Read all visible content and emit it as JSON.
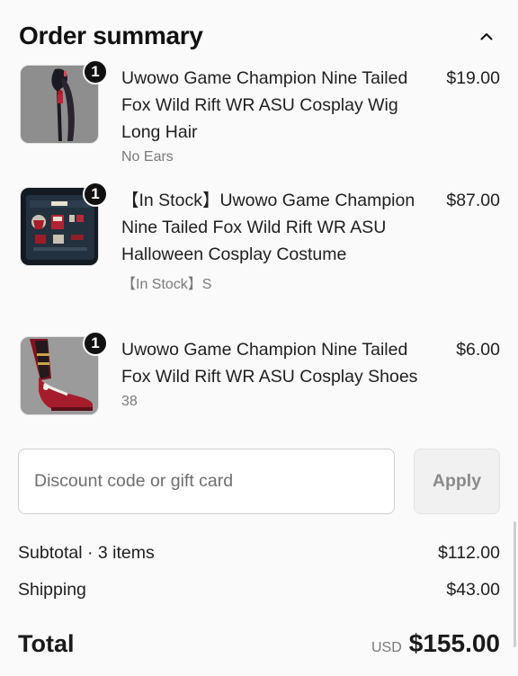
{
  "header": {
    "title": "Order summary",
    "toggle_icon": "chevron-up-icon"
  },
  "items": [
    {
      "quantity": "1",
      "title": "Uwowo Game Champion Nine Tailed Fox Wild Rift WR ASU Cosplay Wig Long Hair",
      "variant": "No Ears",
      "price": "$19.00",
      "image": "wig-product-image"
    },
    {
      "quantity": "1",
      "title": "【In Stock】Uwowo Game Champion Nine Tailed Fox Wild Rift WR ASU Halloween Cosplay Costume",
      "variant": "【In Stock】S",
      "price": "$87.00",
      "image": "costume-product-image"
    },
    {
      "quantity": "1",
      "title": "Uwowo Game Champion Nine Tailed Fox Wild Rift WR ASU Cosplay Shoes",
      "variant": "38",
      "price": "$6.00",
      "image": "shoes-product-image"
    }
  ],
  "discount": {
    "placeholder": "Discount code or gift card",
    "value": "",
    "apply_label": "Apply"
  },
  "summary": {
    "subtotal_label": "Subtotal · 3 items",
    "subtotal_value": "$112.00",
    "shipping_label": "Shipping",
    "shipping_value": "$43.00",
    "total_label": "Total",
    "currency": "USD",
    "total_value": "$155.00"
  }
}
